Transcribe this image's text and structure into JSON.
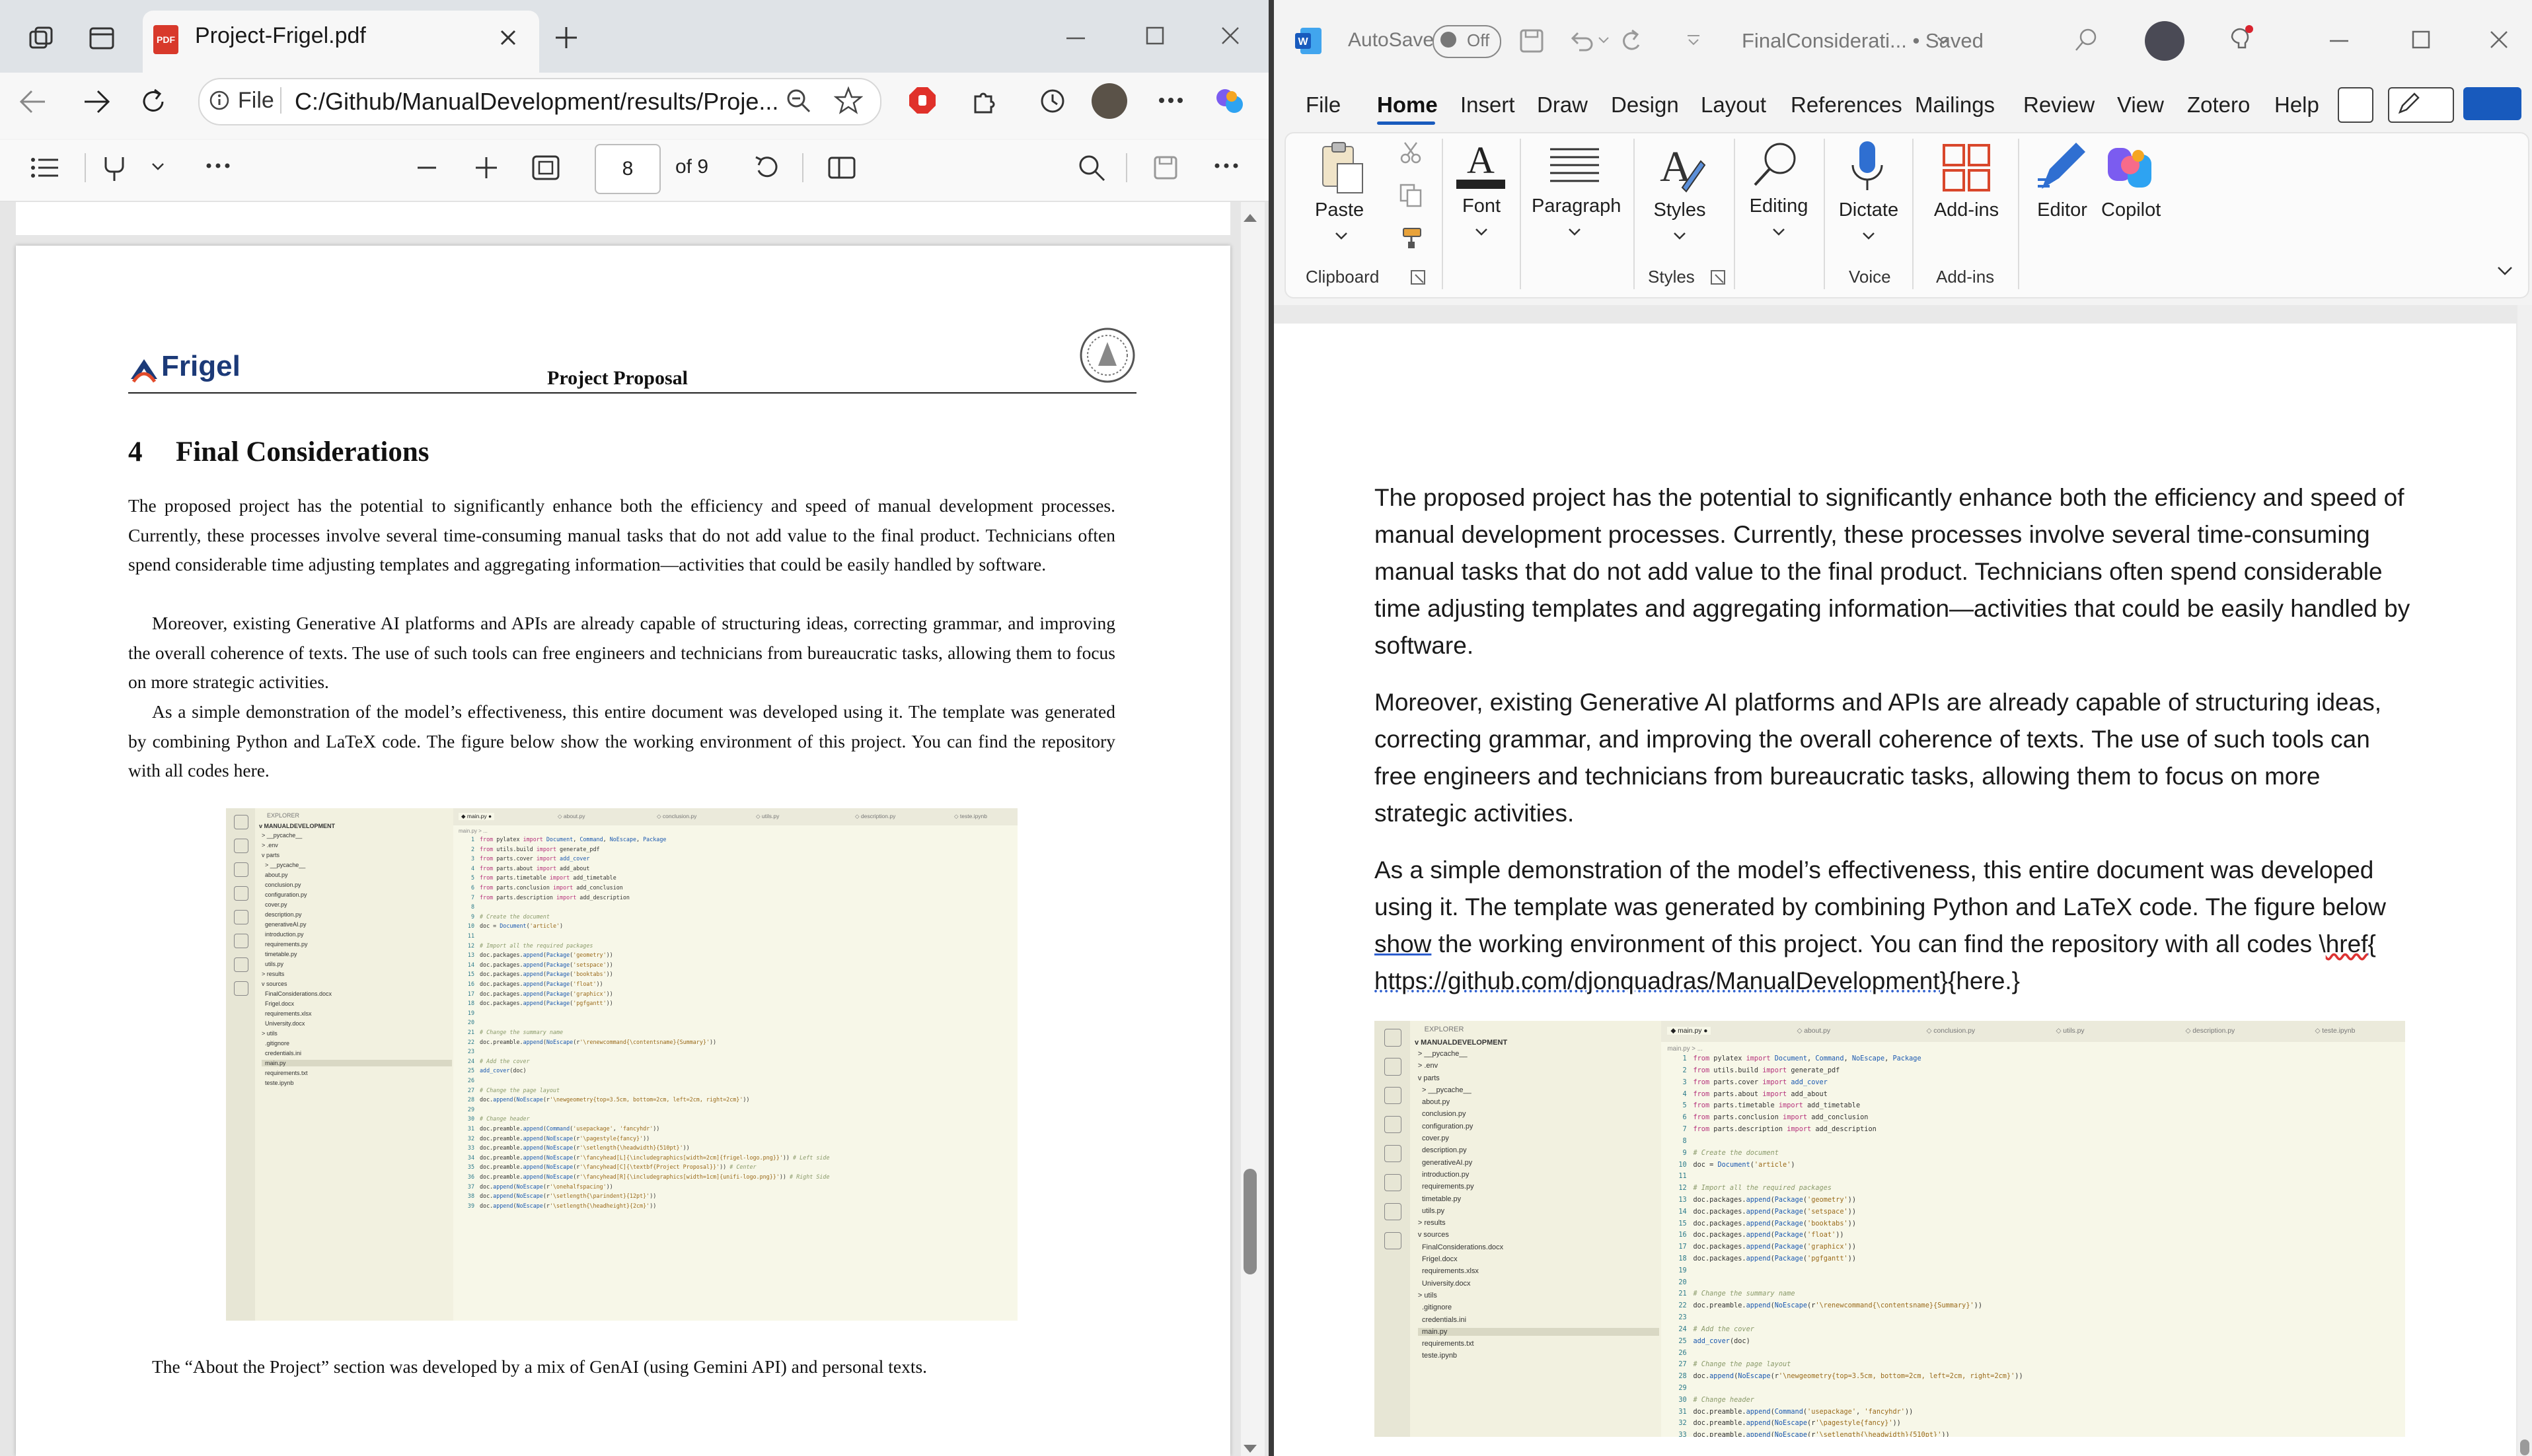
{
  "edge": {
    "tab_title": "Project-Frigel.pdf",
    "pdf_badge": "PDF",
    "address_prefix": "File",
    "address_url": "C:/Github/ManualDevelopment/results/Proje...",
    "page_number": "8",
    "page_total": "of 9"
  },
  "pdf": {
    "logo_text": "Frigel",
    "header_title": "Project Proposal",
    "section_number": "4",
    "section_title": "Final Considerations",
    "paragraphs": [
      "The proposed project has the potential to significantly enhance both the efficiency and speed of manual development processes. Currently, these processes involve several time-consuming manual tasks that do not add value to the final product. Technicians often spend considerable time adjusting templates and aggregating information—activities that could be easily handled by software.",
      "Moreover, existing Generative AI platforms and APIs are already capable of structuring ideas, correcting grammar, and improving the overall coherence of texts. The use of such tools can free engineers and technicians from bureaucratic tasks, allowing them to focus on more strategic activities.",
      "As a simple demonstration of the model’s effectiveness, this entire document was developed using it. The template was generated by combining Python and LaTeX code. The figure below show the working environment of this project. You can find the repository with all codes here."
    ],
    "closing": "The “About the Project” section was developed by a mix of GenAI (using Gemini API) and personal texts."
  },
  "word": {
    "autosave_label": "AutoSave",
    "autosave_state": "Off",
    "doc_title": "FinalConsiderati... • Saved",
    "menu": [
      "File",
      "Home",
      "Insert",
      "Draw",
      "Design",
      "Layout",
      "References",
      "Mailings",
      "Review",
      "View",
      "Zotero",
      "Help"
    ],
    "ribbon": {
      "paste": "Paste",
      "font": "Font",
      "paragraph": "Paragraph",
      "styles": "Styles",
      "editing": "Editing",
      "dictate": "Dictate",
      "addins": "Add-ins",
      "editor": "Editor",
      "copilot": "Copilot",
      "group_clipboard": "Clipboard",
      "group_styles": "Styles",
      "group_voice": "Voice",
      "group_addins": "Add-ins"
    },
    "paragraphs": [
      "The proposed project has the potential to significantly enhance both the efficiency and speed of manual development processes. Currently, these processes involve several time-consuming manual tasks that do not add value to the final product. Technicians often spend considerable time adjusting templates and aggregating information—activities that could be easily handled by software.",
      "Moreover, existing Generative AI platforms and APIs are already capable of structuring ideas, correcting grammar, and improving the overall coherence of texts. The use of such tools can free engineers and technicians from bureaucratic tasks, allowing them to focus on more strategic activities."
    ],
    "para3_start": "As a simple demonstration of the model’s effectiveness, this entire document was developed using it. The template was generated by combining Python and LaTeX code. The figure below ",
    "para3_show": "show",
    "para3_mid": " the working environment of this project. You can find the repository with all codes \\",
    "para3_href": "href",
    "para3_url": "{ https://github.com/djonquadras/ManualDevelopment}",
    "para3_end": "{here.}"
  },
  "vscode": {
    "explorer_title": "EXPLORER",
    "project": "MANUALDEVELOPMENT",
    "breadcrumb": "main.py > ...",
    "tabs": [
      "main.py",
      "about.py",
      "conclusion.py",
      "utils.py",
      "description.py",
      "teste.ipynb"
    ],
    "tree": [
      "> __pycache__",
      "> .env",
      "v parts",
      "  > __pycache__",
      "  about.py",
      "  conclusion.py",
      "  configuration.py",
      "  cover.py",
      "  description.py",
      "  generativeAI.py",
      "  introduction.py",
      "  requirements.py",
      "  timetable.py",
      "  utils.py",
      "> results",
      "v sources",
      "  FinalConsiderations.docx",
      "  Frigel.docx",
      "  requirements.xlsx",
      "  University.docx",
      "> utils",
      "  .gitignore",
      "  credentials.ini",
      "  main.py",
      "  requirements.txt",
      "  teste.ipynb"
    ],
    "code": [
      "from pylatex import Document, Command, NoEscape, Package",
      "from utils.build import generate_pdf",
      "from parts.cover import add_cover",
      "from parts.about import add_about",
      "from parts.timetable import add_timetable",
      "from parts.conclusion import add_conclusion",
      "from parts.description import add_description",
      "",
      "# Create the document",
      "doc = Document('article')",
      "",
      "# Import all the required packages",
      "doc.packages.append(Package('geometry'))",
      "doc.packages.append(Package('setspace'))",
      "doc.packages.append(Package('booktabs'))",
      "doc.packages.append(Package('float'))",
      "doc.packages.append(Package('graphicx'))",
      "doc.packages.append(Package('pgfgantt'))",
      "",
      "",
      "# Change the summary name",
      "doc.preamble.append(NoEscape(r'\\renewcommand{\\contentsname}{Summary}'))",
      "",
      "# Add the cover",
      "add_cover(doc)",
      "",
      "# Change the page layout",
      "doc.append(NoEscape(r'\\newgeometry{top=3.5cm, bottom=2cm, left=2cm, right=2cm}'))",
      "",
      "# Change header",
      "doc.preamble.append(Command('usepackage', 'fancyhdr'))",
      "doc.preamble.append(NoEscape(r'\\pagestyle{fancy}'))",
      "doc.preamble.append(NoEscape(r'\\setlength{\\headwidth}{510pt}'))",
      "doc.preamble.append(NoEscape(r'\\fancyhead[L]{\\includegraphics[width=2cm]{frigel-logo.png}}'))  # Left side",
      "doc.preamble.append(NoEscape(r'\\fancyhead[C]{\\textbf{Project Proposal}}'))  # Center",
      "doc.preamble.append(NoEscape(r'\\fancyhead[R]{\\includegraphics[width=1cm]{unifi-logo.png}}'))  # Right Side",
      "doc.append(NoEscape(r'\\onehalfspacing'))",
      "doc.append(NoEscape(r'\\setlength{\\parindent}{12pt}'))",
      "doc.append(NoEscape(r'\\setlength{\\headheight}{2cm}'))"
    ]
  }
}
